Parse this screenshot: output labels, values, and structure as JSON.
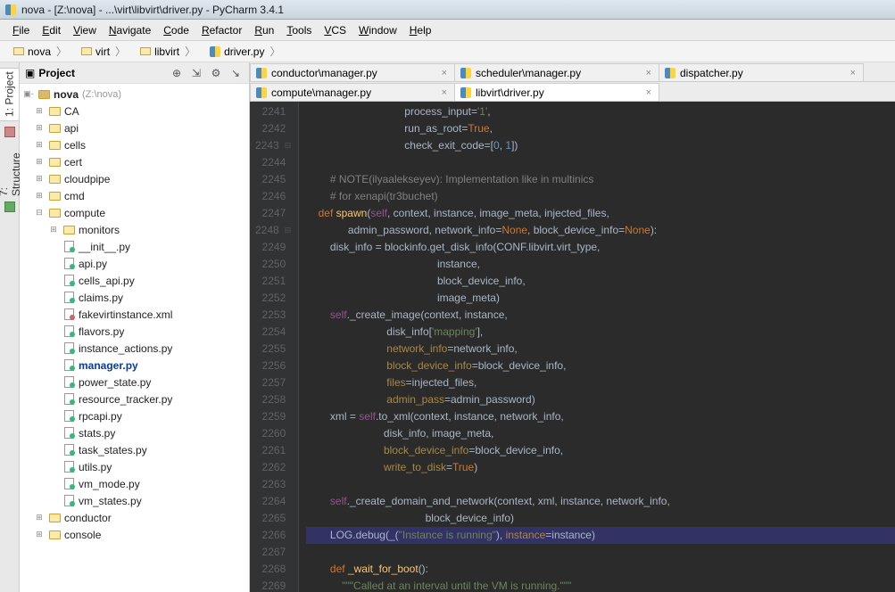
{
  "title": "nova - [Z:\\nova] - ...\\virt\\libvirt\\driver.py - PyCharm 3.4.1",
  "menus": [
    "File",
    "Edit",
    "View",
    "Navigate",
    "Code",
    "Refactor",
    "Run",
    "Tools",
    "VCS",
    "Window",
    "Help"
  ],
  "crumbs": [
    "nova",
    "virt",
    "libvirt",
    "driver.py"
  ],
  "sidetabs": [
    "1: Project",
    "7: Structure"
  ],
  "panel": {
    "title": "Project"
  },
  "tree": {
    "root": {
      "label": "nova",
      "path": "(Z:\\nova)"
    },
    "n": [
      {
        "d": 1,
        "kind": "folder",
        "tw": "+",
        "label": "CA"
      },
      {
        "d": 1,
        "kind": "folder",
        "tw": "+",
        "label": "api"
      },
      {
        "d": 1,
        "kind": "folder",
        "tw": "+",
        "label": "cells"
      },
      {
        "d": 1,
        "kind": "folder",
        "tw": "+",
        "label": "cert"
      },
      {
        "d": 1,
        "kind": "folder",
        "tw": "+",
        "label": "cloudpipe"
      },
      {
        "d": 1,
        "kind": "folder",
        "tw": "+",
        "label": "cmd"
      },
      {
        "d": 1,
        "kind": "folder",
        "tw": "-",
        "label": "compute"
      },
      {
        "d": 2,
        "kind": "folder",
        "tw": "+",
        "label": "monitors"
      },
      {
        "d": 2,
        "kind": "py",
        "tw": "",
        "label": "__init__.py"
      },
      {
        "d": 2,
        "kind": "py",
        "tw": "",
        "label": "api.py"
      },
      {
        "d": 2,
        "kind": "py",
        "tw": "",
        "label": "cells_api.py"
      },
      {
        "d": 2,
        "kind": "py",
        "tw": "",
        "label": "claims.py"
      },
      {
        "d": 2,
        "kind": "xml",
        "tw": "",
        "label": "fakevirtinstance.xml"
      },
      {
        "d": 2,
        "kind": "py",
        "tw": "",
        "label": "flavors.py"
      },
      {
        "d": 2,
        "kind": "py",
        "tw": "",
        "label": "instance_actions.py"
      },
      {
        "d": 2,
        "kind": "py",
        "tw": "",
        "label": "manager.py",
        "sel": true
      },
      {
        "d": 2,
        "kind": "py",
        "tw": "",
        "label": "power_state.py"
      },
      {
        "d": 2,
        "kind": "py",
        "tw": "",
        "label": "resource_tracker.py"
      },
      {
        "d": 2,
        "kind": "py",
        "tw": "",
        "label": "rpcapi.py"
      },
      {
        "d": 2,
        "kind": "py",
        "tw": "",
        "label": "stats.py"
      },
      {
        "d": 2,
        "kind": "py",
        "tw": "",
        "label": "task_states.py"
      },
      {
        "d": 2,
        "kind": "py",
        "tw": "",
        "label": "utils.py"
      },
      {
        "d": 2,
        "kind": "py",
        "tw": "",
        "label": "vm_mode.py"
      },
      {
        "d": 2,
        "kind": "py",
        "tw": "",
        "label": "vm_states.py"
      },
      {
        "d": 1,
        "kind": "folder",
        "tw": "+",
        "label": "conductor"
      },
      {
        "d": 1,
        "kind": "folder",
        "tw": "+",
        "label": "console"
      }
    ]
  },
  "tabs1": [
    {
      "label": "conductor\\manager.py",
      "active": false
    },
    {
      "label": "scheduler\\manager.py",
      "active": false
    },
    {
      "label": "dispatcher.py",
      "active": false
    }
  ],
  "tabs2": [
    {
      "label": "compute\\manager.py",
      "active": false
    },
    {
      "label": "libvirt\\driver.py",
      "active": true
    }
  ],
  "code": {
    "start": 2241,
    "current": 2266,
    "marks": {
      "2243": "-",
      "2248": "-"
    },
    "lines": [
      {
        "n": 2241,
        "html": "                                 process_input=<span class='c-str'>'1'</span>,"
      },
      {
        "n": 2242,
        "html": "                                 run_as_root=<span class='c-kw'>True</span>,"
      },
      {
        "n": 2243,
        "html": "                                 check_exit_code=[<span class='c-num'>0</span>, <span class='c-num'>1</span>])"
      },
      {
        "n": 2244,
        "html": ""
      },
      {
        "n": 2245,
        "html": "        <span class='c-cmt'># NOTE(ilyaalekseyev): Implementation like in multinics</span>"
      },
      {
        "n": 2246,
        "html": "        <span class='c-cmt'># for xenapi(tr3buchet)</span>"
      },
      {
        "n": 2247,
        "html": "    <span class='c-kw'>def</span> <span class='c-fn'>spawn</span>(<span class='c-self'>self</span>, context, instance, image_meta, injected_files,"
      },
      {
        "n": 2248,
        "html": "              admin_password, network_info=<span class='c-kw'>None</span>, block_device_info=<span class='c-kw'>None</span>):"
      },
      {
        "n": 2249,
        "html": "        disk_info = blockinfo.get_disk_info(CONF.libvirt.virt_type,"
      },
      {
        "n": 2250,
        "html": "                                            instance,"
      },
      {
        "n": 2251,
        "html": "                                            block_device_info,"
      },
      {
        "n": 2252,
        "html": "                                            image_meta)"
      },
      {
        "n": 2253,
        "html": "        <span class='c-self'>self</span>._create_image(context, instance,"
      },
      {
        "n": 2254,
        "html": "                           disk_info[<span class='c-str'>'mapping'</span>],"
      },
      {
        "n": 2255,
        "html": "                           <span class='c-kwarg'>network_info</span>=network_info,"
      },
      {
        "n": 2256,
        "html": "                           <span class='c-kwarg'>block_device_info</span>=block_device_info,"
      },
      {
        "n": 2257,
        "html": "                           <span class='c-kwarg'>files</span>=injected_files,"
      },
      {
        "n": 2258,
        "html": "                           <span class='c-kwarg'>admin_pass</span>=admin_password)"
      },
      {
        "n": 2259,
        "html": "        xml = <span class='c-self'>self</span>.to_xml(context, instance, network_info,"
      },
      {
        "n": 2260,
        "html": "                          disk_info, image_meta,"
      },
      {
        "n": 2261,
        "html": "                          <span class='c-kwarg'>block_device_info</span>=block_device_info,"
      },
      {
        "n": 2262,
        "html": "                          <span class='c-kwarg'>write_to_disk</span>=<span class='c-kw'>True</span>)"
      },
      {
        "n": 2263,
        "html": ""
      },
      {
        "n": 2264,
        "html": "        <span class='c-self'>self</span>._create_domain_and_network(context, xml, instance, network_info,"
      },
      {
        "n": 2265,
        "html": "                                        block_device_info)"
      },
      {
        "n": 2266,
        "html": "        LOG.debug(_(<span class='c-str'>\"Instance is running\"</span>), <span class='c-kwarg'>instance</span>=instance)"
      },
      {
        "n": 2267,
        "html": ""
      },
      {
        "n": 2268,
        "html": "        <span class='c-kw'>def</span> <span class='c-fn'>_wait_for_boot</span>():"
      },
      {
        "n": 2269,
        "html": "            <span class='c-str'>\"\"\"Called at an interval until the VM is running.\"\"\"</span>"
      }
    ]
  }
}
